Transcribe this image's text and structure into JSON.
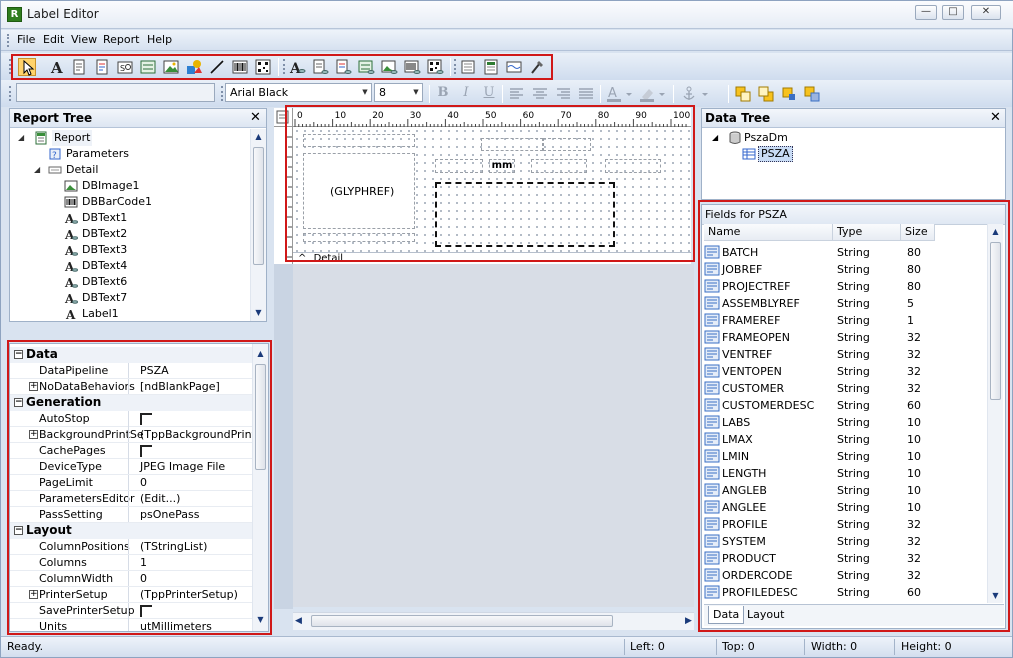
{
  "window": {
    "title": "Label Editor",
    "app_icon_letter": "R"
  },
  "menu": [
    "File",
    "Edit",
    "View",
    "Report",
    "Help"
  ],
  "toolbars": {
    "components": [
      "pointer-icon",
      "label-icon",
      "memo-icon",
      "richtext-icon",
      "system-variable-icon",
      "variable-icon",
      "image-icon",
      "shape-icon",
      "line-icon",
      "barcode-icon",
      "2d-barcode-icon"
    ],
    "db_components": [
      "dbtext-icon",
      "dbmemo-icon",
      "dbrichtext-icon",
      "dbcalc-icon",
      "dbimage-icon",
      "dbbarcode-icon",
      "db2d-barcode-icon"
    ],
    "bands": [
      "region-icon",
      "subreport-icon",
      "page-break-icon",
      "crossref-icon"
    ],
    "font_name": "Arial Black",
    "font_size": "8",
    "format": [
      "bold-icon",
      "italic-icon",
      "underline-icon",
      "align-left-icon",
      "align-center-icon",
      "align-right-icon",
      "justify-icon",
      "font-color-icon",
      "highlight-icon",
      "anchor-icon",
      "bring-front-icon",
      "send-back-icon",
      "align-objects-icon",
      "size-objects-icon"
    ]
  },
  "report_tree": {
    "title": "Report Tree",
    "items": [
      {
        "label": "Report",
        "icon": "report-icon",
        "level": 0,
        "expander": "open"
      },
      {
        "label": "Parameters",
        "icon": "parameters-icon",
        "level": 1,
        "expander": ""
      },
      {
        "label": "Detail",
        "icon": "band-icon",
        "level": 1,
        "expander": "open"
      },
      {
        "label": "DBImage1",
        "icon": "dbimage-icon",
        "level": 2,
        "expander": ""
      },
      {
        "label": "DBBarCode1",
        "icon": "dbbarcode-icon",
        "level": 2,
        "expander": ""
      },
      {
        "label": "DBText1",
        "icon": "dbtext-icon",
        "level": 2,
        "expander": ""
      },
      {
        "label": "DBText2",
        "icon": "dbtext-icon",
        "level": 2,
        "expander": ""
      },
      {
        "label": "DBText3",
        "icon": "dbtext-icon",
        "level": 2,
        "expander": ""
      },
      {
        "label": "DBText4",
        "icon": "dbtext-icon",
        "level": 2,
        "expander": ""
      },
      {
        "label": "DBText6",
        "icon": "dbtext-icon",
        "level": 2,
        "expander": ""
      },
      {
        "label": "DBText7",
        "icon": "dbtext-icon",
        "level": 2,
        "expander": ""
      },
      {
        "label": "Label1",
        "icon": "label-icon",
        "level": 2,
        "expander": ""
      }
    ]
  },
  "inspector": {
    "rows": [
      {
        "kind": "category",
        "name": "Data"
      },
      {
        "kind": "prop",
        "name": "DataPipeline",
        "value": "PSZA",
        "expand": false,
        "check": false
      },
      {
        "kind": "prop",
        "name": "NoDataBehaviors",
        "value": "[ndBlankPage]",
        "expand": true,
        "check": false
      },
      {
        "kind": "category",
        "name": "Generation"
      },
      {
        "kind": "prop",
        "name": "AutoStop",
        "value": "",
        "expand": false,
        "check": true
      },
      {
        "kind": "prop",
        "name": "BackgroundPrintSe",
        "value": "(TppBackgroundPrintSett",
        "expand": true,
        "check": false
      },
      {
        "kind": "prop",
        "name": "CachePages",
        "value": "",
        "expand": false,
        "check": true
      },
      {
        "kind": "prop",
        "name": "DeviceType",
        "value": "JPEG Image File",
        "expand": false,
        "check": false
      },
      {
        "kind": "prop",
        "name": "PageLimit",
        "value": "0",
        "expand": false,
        "check": false
      },
      {
        "kind": "prop",
        "name": "ParametersEditor",
        "value": "(Edit...)",
        "expand": false,
        "check": false
      },
      {
        "kind": "prop",
        "name": "PassSetting",
        "value": "psOnePass",
        "expand": false,
        "check": false
      },
      {
        "kind": "category",
        "name": "Layout"
      },
      {
        "kind": "prop",
        "name": "ColumnPositions",
        "value": "(TStringList)",
        "expand": false,
        "check": false
      },
      {
        "kind": "prop",
        "name": "Columns",
        "value": "1",
        "expand": false,
        "check": false
      },
      {
        "kind": "prop",
        "name": "ColumnWidth",
        "value": "0",
        "expand": false,
        "check": false
      },
      {
        "kind": "prop",
        "name": "PrinterSetup",
        "value": "(TppPrinterSetup)",
        "expand": true,
        "check": false
      },
      {
        "kind": "prop",
        "name": "SavePrinterSetup",
        "value": "",
        "expand": false,
        "check": true
      },
      {
        "kind": "prop",
        "name": "Units",
        "value": "utMillimeters",
        "expand": false,
        "check": false
      }
    ]
  },
  "designer": {
    "ruler_labels": [
      "0",
      "10",
      "20",
      "30",
      "40",
      "50",
      "60",
      "70",
      "80",
      "90",
      "100"
    ],
    "glyph_text": "(GLYPHREF)",
    "mm_text": "mm",
    "band_label": "Detail",
    "band_marker": "^"
  },
  "data_tree": {
    "title": "Data Tree",
    "items": [
      {
        "label": "PszaDm",
        "icon": "datamodule-icon",
        "level": 0,
        "expander": "open"
      },
      {
        "label": "PSZA",
        "icon": "table-icon",
        "level": 1,
        "expander": "",
        "selected": true
      }
    ]
  },
  "fields": {
    "title": "Fields for PSZA",
    "columns": [
      "Name",
      "Type",
      "Size"
    ],
    "rows": [
      [
        "BATCH",
        "String",
        "80"
      ],
      [
        "JOBREF",
        "String",
        "80"
      ],
      [
        "PROJECTREF",
        "String",
        "80"
      ],
      [
        "ASSEMBLYREF",
        "String",
        "5"
      ],
      [
        "FRAMEREF",
        "String",
        "1"
      ],
      [
        "FRAMEOPEN",
        "String",
        "32"
      ],
      [
        "VENTREF",
        "String",
        "32"
      ],
      [
        "VENTOPEN",
        "String",
        "32"
      ],
      [
        "CUSTOMER",
        "String",
        "32"
      ],
      [
        "CUSTOMERDESC",
        "String",
        "60"
      ],
      [
        "LABS",
        "String",
        "10"
      ],
      [
        "LMAX",
        "String",
        "10"
      ],
      [
        "LMIN",
        "String",
        "10"
      ],
      [
        "LENGTH",
        "String",
        "10"
      ],
      [
        "ANGLEB",
        "String",
        "10"
      ],
      [
        "ANGLEE",
        "String",
        "10"
      ],
      [
        "PROFILE",
        "String",
        "32"
      ],
      [
        "SYSTEM",
        "String",
        "32"
      ],
      [
        "PRODUCT",
        "String",
        "32"
      ],
      [
        "ORDERCODE",
        "String",
        "32"
      ],
      [
        "PROFILEDESC",
        "String",
        "60"
      ]
    ],
    "tabs": [
      "Data",
      "Layout"
    ]
  },
  "status": {
    "text": "Ready.",
    "left": "Left: 0",
    "top": "Top: 0",
    "width": "Width: 0",
    "height": "Height: 0"
  },
  "colors": {
    "highlight_red": "#d01818",
    "selection": "#c9dcf5",
    "accent": "#2f7d1e"
  }
}
